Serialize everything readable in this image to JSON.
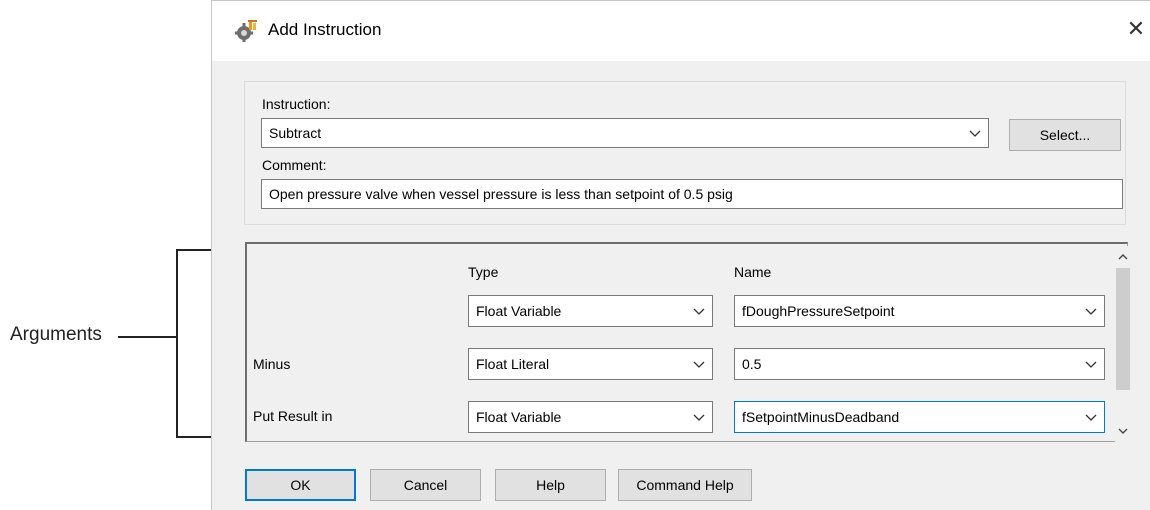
{
  "annotation": {
    "label": "Arguments"
  },
  "dialog": {
    "title": "Add Instruction",
    "close_symbol": "✕",
    "instruction": {
      "label": "Instruction:",
      "value": "Subtract",
      "select_button": "Select..."
    },
    "comment": {
      "label": "Comment:",
      "value": "Open pressure valve when vessel pressure is less than setpoint of 0.5 psig"
    },
    "arguments": {
      "col_type_header": "Type",
      "col_name_header": "Name",
      "rows": [
        {
          "label": "",
          "type": "Float Variable",
          "name": "fDoughPressureSetpoint"
        },
        {
          "label": "Minus",
          "type": "Float Literal",
          "name": "0.5"
        },
        {
          "label": "Put Result in",
          "type": "Float Variable",
          "name": "fSetpointMinusDeadband"
        }
      ],
      "scroll_up": "^",
      "scroll_down": "v"
    },
    "buttons": {
      "ok": "OK",
      "cancel": "Cancel",
      "help": "Help",
      "command_help": "Command Help"
    }
  }
}
